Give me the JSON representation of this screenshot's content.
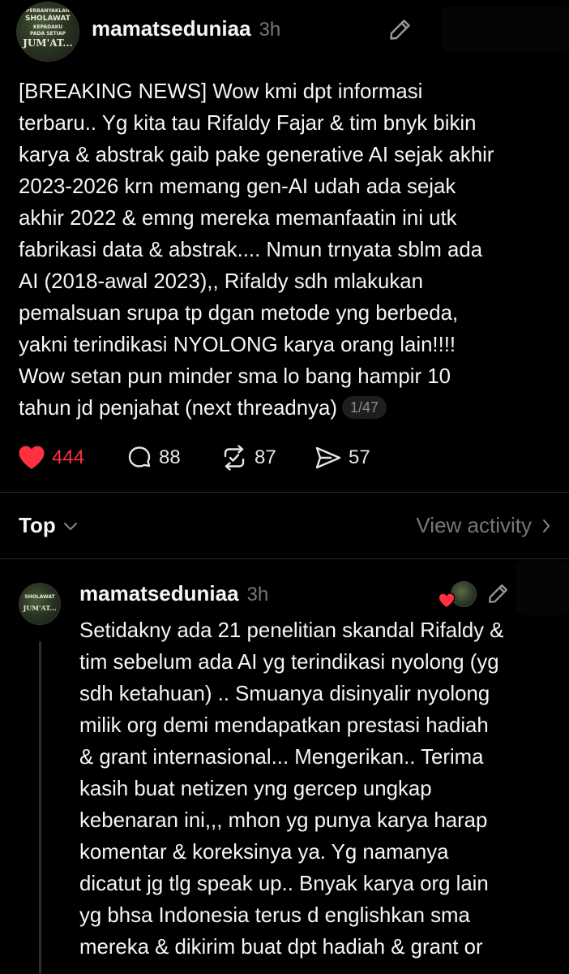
{
  "main_post": {
    "username": "mamatseduniaa",
    "time": "3h",
    "avatar_text": [
      "PERBANYAKLAH",
      "SHOLAWAT",
      "KEPADAKU",
      "PADA SETIAP",
      "JUM'AT..."
    ],
    "text": "[BREAKING NEWS] Wow kmi dpt informasi\nterbaru.. Yg kita tau Rifaldy Fajar & tim bnyk bikin\nkarya & abstrak gaib pake generative AI sejak akhir\n2023-2026 krn memang gen-AI udah ada sejak\nakhir 2022 & emng mereka memanfaatin ini utk\nfabrikasi data & abstrak.... Nmun trnyata sblm ada\nAI (2018-awal 2023),, Rifaldy sdh mlakukan\npemalsuan srupa tp dgan metode yng berbeda,\nyakni terindikasi NYOLONG karya orang lain!!!!\nWow setan pun minder sma lo bang hampir 10\ntahun jd penjahat (next threadnya)",
    "thread_count": "1/47",
    "likes": "444",
    "comments": "88",
    "reposts": "87",
    "shares": "57"
  },
  "sort_bar": {
    "label": "Top",
    "activity_link": "View activity"
  },
  "reply_post": {
    "username": "mamatseduniaa",
    "time": "3h",
    "text": "Setidakny ada 21 penelitian skandal Rifaldy &\ntim sebelum ada AI yg terindikasi nyolong (yg\nsdh ketahuan) .. Smuanya disinyalir nyolong\nmilik org demi mendapatkan prestasi hadiah\n& grant internasional... Mengerikan.. Terima\nkasih buat netizen yng gercep ungkap\nkebenaran ini,,, mhon yg punya karya harap\nkomentar & koreksinya ya. Yg namanya\ndicatut jg tlg speak up.. Bnyak karya org lain\nyg bhsa Indonesia terus d englishkan sma\nmereka & dikirim buat dpt hadiah & grant or"
  },
  "colors": {
    "background": "#000000",
    "text": "#f3f5f7",
    "muted": "#777777",
    "like_red": "#ff3040"
  }
}
